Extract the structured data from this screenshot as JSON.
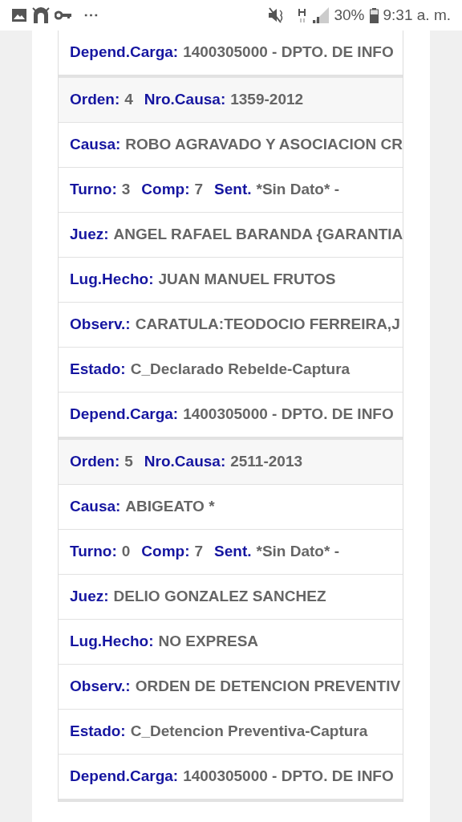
{
  "status_bar": {
    "more": "⋯",
    "battery_percent": "30%",
    "time": "9:31 a. m."
  },
  "records": [
    {
      "rows": [
        {
          "kind": "field",
          "items": [
            {
              "label": "Depend.Carga:",
              "value": "1400305000 - DPTO. DE INFO"
            }
          ]
        }
      ]
    },
    {
      "rows": [
        {
          "kind": "header",
          "items": [
            {
              "label": "Orden:",
              "value": "4"
            },
            {
              "label": "Nro.Causa:",
              "value": "1359-2012"
            }
          ]
        },
        {
          "kind": "field",
          "items": [
            {
              "label": "Causa:",
              "value": "ROBO AGRAVADO Y ASOCIACION CR"
            }
          ]
        },
        {
          "kind": "field",
          "items": [
            {
              "label": "Turno:",
              "value": "3"
            },
            {
              "label": "Comp:",
              "value": "7"
            },
            {
              "label": "Sent.",
              "value": "*Sin Dato* -"
            }
          ]
        },
        {
          "kind": "field",
          "items": [
            {
              "label": "Juez:",
              "value": "ANGEL RAFAEL BARANDA {GARANTIA"
            }
          ]
        },
        {
          "kind": "field",
          "items": [
            {
              "label": "Lug.Hecho:",
              "value": "JUAN MANUEL FRUTOS"
            }
          ]
        },
        {
          "kind": "field",
          "items": [
            {
              "label": "Observ.:",
              "value": "CARATULA:TEODOCIO FERREIRA,J"
            }
          ]
        },
        {
          "kind": "field",
          "items": [
            {
              "label": "Estado:",
              "value": "C_Declarado Rebelde-Captura"
            }
          ]
        },
        {
          "kind": "field",
          "items": [
            {
              "label": "Depend.Carga:",
              "value": "1400305000 - DPTO. DE INFO"
            }
          ]
        }
      ]
    },
    {
      "rows": [
        {
          "kind": "header",
          "items": [
            {
              "label": "Orden:",
              "value": "5"
            },
            {
              "label": "Nro.Causa:",
              "value": "2511-2013"
            }
          ]
        },
        {
          "kind": "field",
          "items": [
            {
              "label": "Causa:",
              "value": "ABIGEATO *"
            }
          ]
        },
        {
          "kind": "field",
          "items": [
            {
              "label": "Turno:",
              "value": "0"
            },
            {
              "label": "Comp:",
              "value": "7"
            },
            {
              "label": "Sent.",
              "value": "*Sin Dato* -"
            }
          ]
        },
        {
          "kind": "field",
          "items": [
            {
              "label": "Juez:",
              "value": "DELIO GONZALEZ SANCHEZ"
            }
          ]
        },
        {
          "kind": "field",
          "items": [
            {
              "label": "Lug.Hecho:",
              "value": "NO EXPRESA"
            }
          ]
        },
        {
          "kind": "field",
          "items": [
            {
              "label": "Observ.:",
              "value": "ORDEN DE DETENCION PREVENTIV"
            }
          ]
        },
        {
          "kind": "field",
          "items": [
            {
              "label": "Estado:",
              "value": "C_Detencion Preventiva-Captura"
            }
          ]
        },
        {
          "kind": "field",
          "items": [
            {
              "label": "Depend.Carga:",
              "value": "1400305000 - DPTO. DE INFO"
            }
          ]
        }
      ]
    }
  ]
}
